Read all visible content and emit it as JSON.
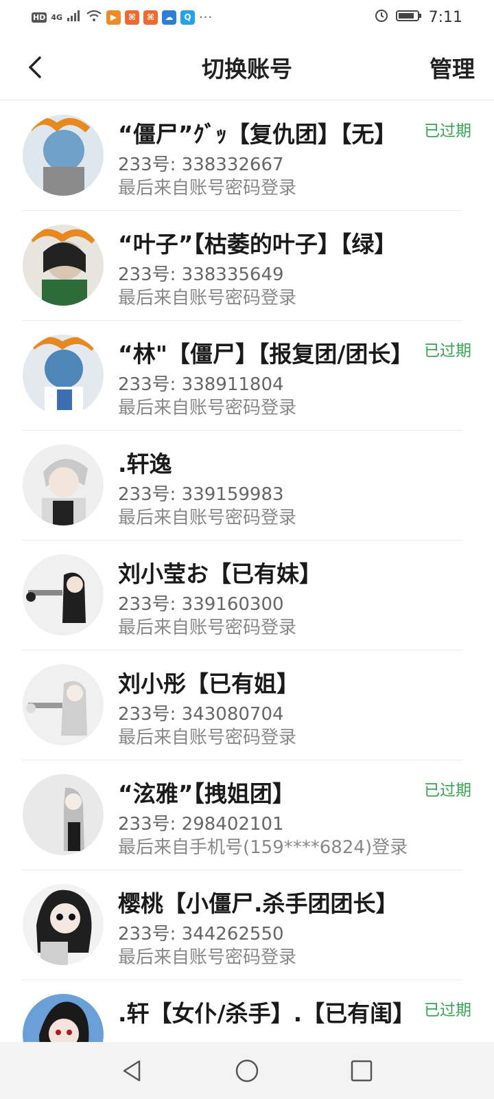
{
  "status_bar": {
    "hd": "HD",
    "network": "4G",
    "time": "7:11",
    "icons": [
      "signal-icon",
      "wifi-icon",
      "app-icon",
      "app-icon",
      "app-icon",
      "app-icon",
      "app-icon",
      "alarm-icon",
      "battery-icon"
    ]
  },
  "header": {
    "title": "切换账号",
    "manage_label": "管理"
  },
  "accounts": [
    {
      "name": "“僵尸”ｸﾞｯ【复仇团】【无】",
      "uid": "233号: 338332667",
      "login": "最后来自账号密码登录",
      "expired": "已过期",
      "avatar_color": "#6fa0c8"
    },
    {
      "name": "“叶子”【枯萎的叶子】【绿】",
      "uid": "233号: 338335649",
      "login": "最后来自账号密码登录",
      "expired": "",
      "avatar_color": "#2e6b3a"
    },
    {
      "name": "“林\"【僵尸】【报复团/团长】",
      "uid": "233号: 338911804",
      "login": "最后来自账号密码登录",
      "expired": "已过期",
      "avatar_color": "#4f86b8"
    },
    {
      "name": ".轩逸",
      "uid": "233号: 339159983",
      "login": "最后来自账号密码登录",
      "expired": "",
      "avatar_color": "#c9c9c9"
    },
    {
      "name": "刘小莹お【已有妹】",
      "uid": "233号: 339160300",
      "login": "最后来自账号密码登录",
      "expired": "",
      "avatar_color": "#222222"
    },
    {
      "name": "刘小彤【已有姐】",
      "uid": "233号: 343080704",
      "login": "最后来自账号密码登录",
      "expired": "",
      "avatar_color": "#bdbdbd"
    },
    {
      "name": "“泫雅”【拽姐团】",
      "uid": "233号: 298402101",
      "login": "最后来自手机号(159****6824)登录",
      "expired": "已过期",
      "avatar_color": "#e9e9e9"
    },
    {
      "name": "樱桃【小僵尸.杀手团团长】",
      "uid": "233号: 344262550",
      "login": "最后来自账号密码登录",
      "expired": "",
      "avatar_color": "#1f1f1f"
    },
    {
      "name": ".轩【女仆/杀手】.【已有闺】",
      "uid": "",
      "login": "",
      "expired": "已过期",
      "avatar_color": "#6a9fd8"
    }
  ],
  "colors": {
    "expired": "#35a552",
    "divider": "#ececec"
  }
}
